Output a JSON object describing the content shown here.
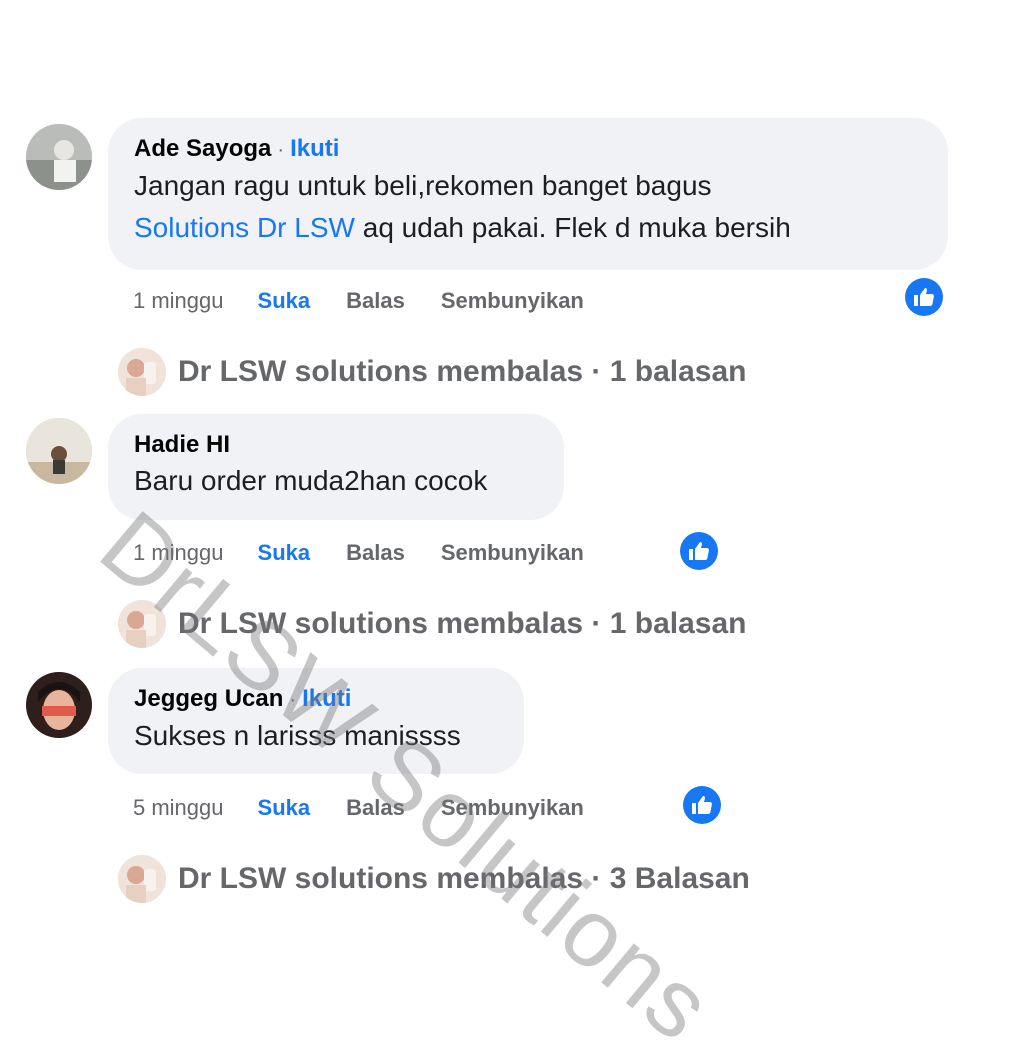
{
  "comments": [
    {
      "author": "Ade Sayoga",
      "follow_label": "Ikuti",
      "line1": "Jangan ragu untuk beli,rekomen banget bagus",
      "mention": "Solutions Dr LSW",
      "line2_rest": " aq udah pakai. Flek d muka bersih",
      "time": "1 minggu",
      "like_label": "Suka",
      "reply_label": "Balas",
      "hide_label": "Sembunyikan",
      "replies_text": "Dr LSW solutions membalas · 1 balasan"
    },
    {
      "author": "Hadie HI",
      "text": "Baru order muda2han cocok",
      "time": "1 minggu",
      "like_label": "Suka",
      "reply_label": "Balas",
      "hide_label": "Sembunyikan",
      "replies_text": "Dr LSW solutions membalas · 1 balasan"
    },
    {
      "author": "Jeggeg Ucan",
      "follow_label": "Ikuti",
      "text": "Sukses n larisss manissss",
      "time": "5 minggu",
      "like_label": "Suka",
      "reply_label": "Balas",
      "hide_label": "Sembunyikan",
      "replies_text": "Dr LSW solutions membalas · 3 Balasan"
    }
  ],
  "watermark": "DrLSW Solutions",
  "icons": {
    "reaction": "thumbs-up-icon"
  },
  "colors": {
    "accent": "#1877f2",
    "bubble": "#f0f2f5",
    "muted": "#65676b"
  }
}
